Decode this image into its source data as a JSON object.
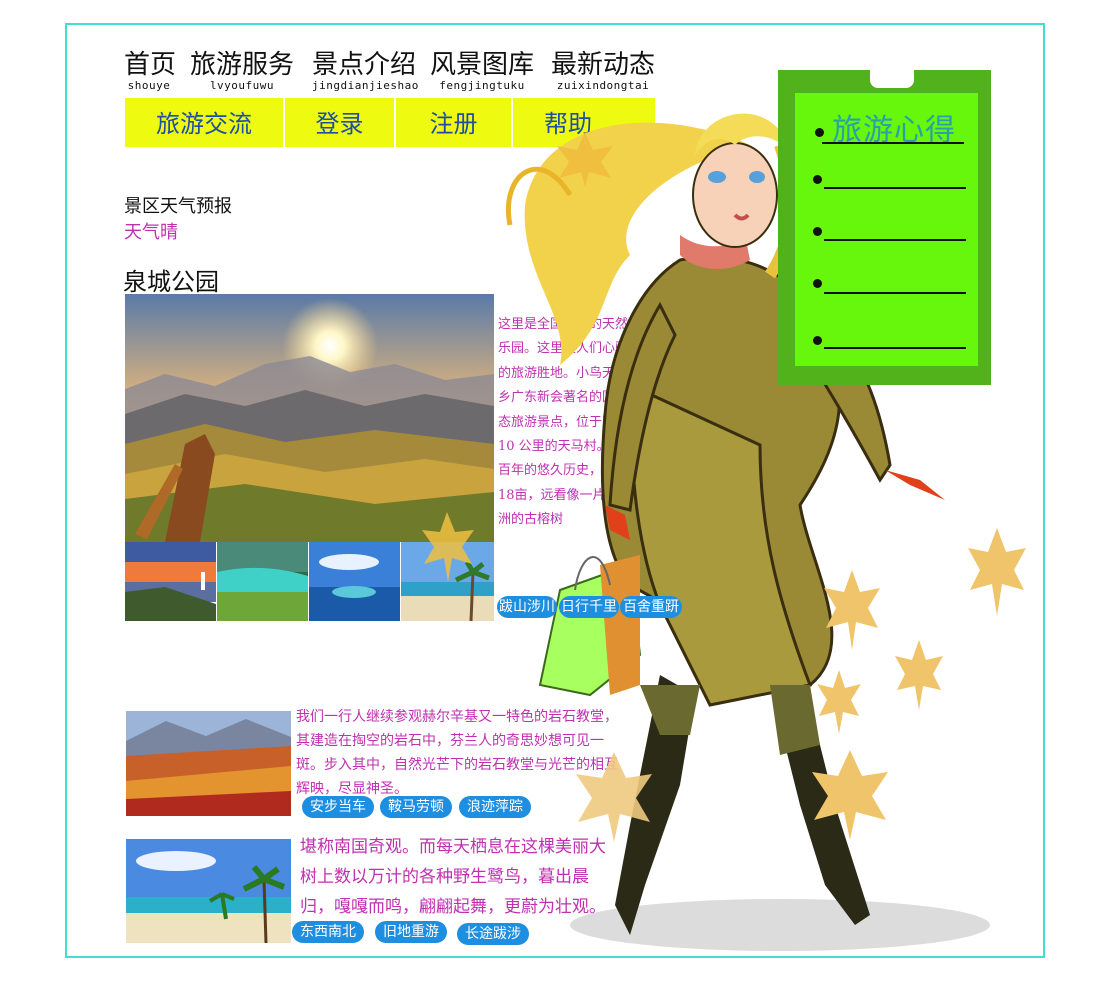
{
  "nav": [
    {
      "label": "首页",
      "pinyin": "shouye"
    },
    {
      "label": "旅游服务",
      "pinyin": "lvyoufuwu"
    },
    {
      "label": "景点介绍",
      "pinyin": "jingdianjieshao"
    },
    {
      "label": "风景图库",
      "pinyin": "fengjingtuku"
    },
    {
      "label": "最新动态",
      "pinyin": "zuixindongtai"
    }
  ],
  "subnav": [
    "旅游交流",
    "登录",
    "注册",
    "帮助"
  ],
  "weather": {
    "title": "景区天气预报",
    "value": "天气晴"
  },
  "park": {
    "title": "泉城公园"
  },
  "section1": {
    "text": "这里是全国最大的天然赏鸟乐园。这里是人们心驰神往的旅游胜地。小鸟天堂是侨乡广东新会著名的国际级生态旅游景点，位于距城区10 公里的天马村。她以数百年的悠久历史，占地达 18亩，远看像一片浮动绿洲的古榕树",
    "tags": [
      "跋山涉川",
      "日行千里",
      "百舍重趼"
    ]
  },
  "section2": {
    "text": "我们一行人继续参观赫尔辛基又一特色的岩石教堂，其建造在掏空的岩石中，芬兰人的奇思妙想可见一斑。步入其中，自然光芒下的岩石教堂与光芒的相互辉映，尽显神圣。",
    "tags": [
      "安步当车",
      "鞍马劳顿",
      "浪迹萍踪"
    ]
  },
  "section3": {
    "text": "堪称南国奇观。而每天栖息在这棵美丽大树上数以万计的各种野生鹭鸟，暮出晨归，嘎嘎而鸣，翩翩起舞，更蔚为壮观。",
    "tags": [
      "东西南北",
      "旧地重游",
      "长途跋涉"
    ]
  },
  "panel": {
    "title": "旅游心得",
    "items": [
      "",
      "",
      "",
      "",
      ""
    ]
  },
  "colors": {
    "frame": "#40e0d0",
    "subnav_bg": "#eefb11",
    "subnav_text": "#1e4fa3",
    "accent_text": "#c030b0",
    "tag_bg": "#1e8fe0",
    "panel_outer": "#52b21b",
    "panel_inner": "#66f70c",
    "panel_title": "#2aa0a8"
  }
}
